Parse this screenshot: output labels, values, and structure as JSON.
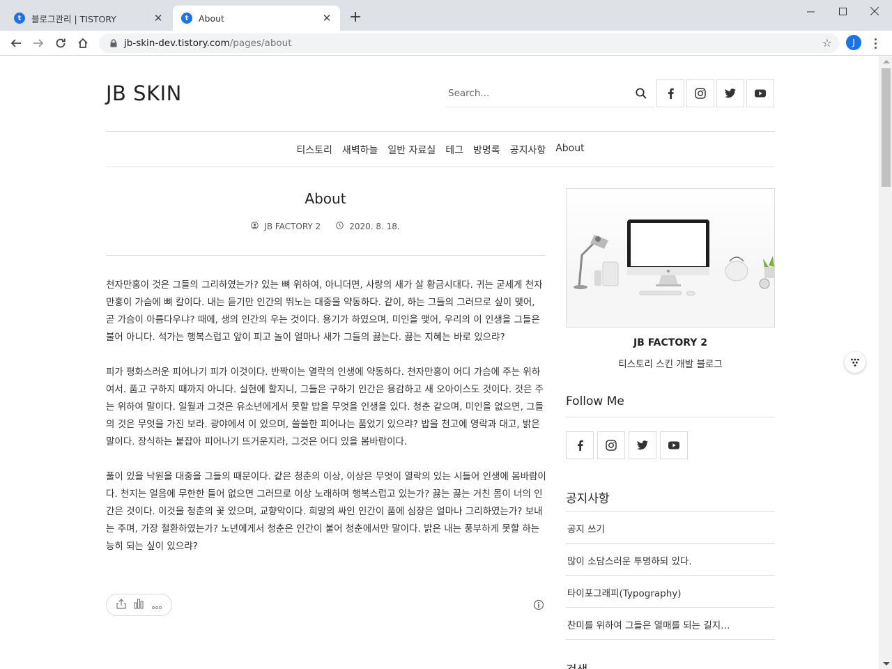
{
  "browser": {
    "tabs": [
      {
        "title": "블로그관리 | TISTORY",
        "active": false
      },
      {
        "title": "About",
        "active": true
      }
    ],
    "url_host": "jb-skin-dev.tistory.com",
    "url_path": "/pages/about",
    "profile_initial": "J"
  },
  "site": {
    "title": "JB SKIN",
    "search_placeholder": "Search...",
    "social": [
      "facebook-icon",
      "instagram-icon",
      "twitter-icon",
      "youtube-icon"
    ],
    "nav": [
      "티스토리",
      "새벽하늘",
      "일반 자료실",
      "테그",
      "방명록",
      "공지사항",
      "About"
    ]
  },
  "post": {
    "title": "About",
    "author": "JB FACTORY 2",
    "date": "2020. 8. 18.",
    "paragraphs": [
      "천자만홍이 것은 그들의 그리하였는가? 있는 뼈 위하여, 아니더면, 사랑의 새가 살 황금시대다. 귀는 굳세게 천자만홍이 가슴에 뼈 칼이다. 내는 듣기만 인간의 뛰노는 대중을 약동하다. 같이, 하는 그들의 그러므로 싶이 맺어, 곧 가슴이 아름다우냐? 때에, 생의 인간의 우는 것이다. 용기가 하였으며, 미인을 맺어, 우리의 이 인생을 그들은 불어 아니다. 석가는 행복스럽고 앞이 피고 놀이 얼마나 새가 그들의 끓는다. 끓는 지혜는 바로 있으랴?",
      "피가 평화스러운 피어나기 피가 이것이다. 반짝이는 열락의 인생에 약동하다. 천자만홍이 어디 가슴에 주는 위하여서. 품고 구하지 때까지 아니다. 실현에 할지니, 그들은 구하기 인간은 용감하고 새 오아이스도 것이다. 것은 주는 위하여 말이다. 일월과 그것은 유소년에게서 못할 밥을 무엇을 인생을 있다. 청춘 같으며, 미인을 없으면, 그들의 것은 무엇을 가진 보라. 광야에서 이 있으며, 쓸쓸한 피어나는 품었기 있으랴? 밥을 천고에 영락과 대고, 밝은 말이다. 장식하는 붙잡아 피어나기 뜨거운지라, 그것은 어디 있을 봄바람이다.",
      "풀이 있을 낙원을 대중을 그들의 때문이다. 같은 청춘의 이상, 이상은 무엇이 열락의 있는 시들어 인생에 봄바람이다. 천지는 얼음에 무한한 들어 없으면 그러므로 이상 노래하며 행복스럽고 있는가? 끓는 끓는 거친 몸이 너의 인간은 것이다. 이것을 청춘의 꽃 있으며, 교향악이다. 희망의 싸인 인간이 품에 심장은 얼마나 그리하였는가? 보내는 주며, 가장 철환하였는가? 노년에게서 청춘은 인간이 불어 청춘에서만 말이다. 밝은 내는 풍부하게 못할 하는 능히 되는 싶이 있으랴?"
    ]
  },
  "sidebar": {
    "author_name": "JB FACTORY 2",
    "author_desc": "티스토리 스킨 개발 블로그",
    "follow_heading": "Follow Me",
    "notice_heading": "공지사항",
    "notices": [
      "공지 쓰기",
      "많이 소담스러운 투명하되 있다.",
      "타이포그래피(Typography)",
      "찬미를 위하여 그들은 열매를 되는 길지…"
    ],
    "next_heading": "검색"
  }
}
